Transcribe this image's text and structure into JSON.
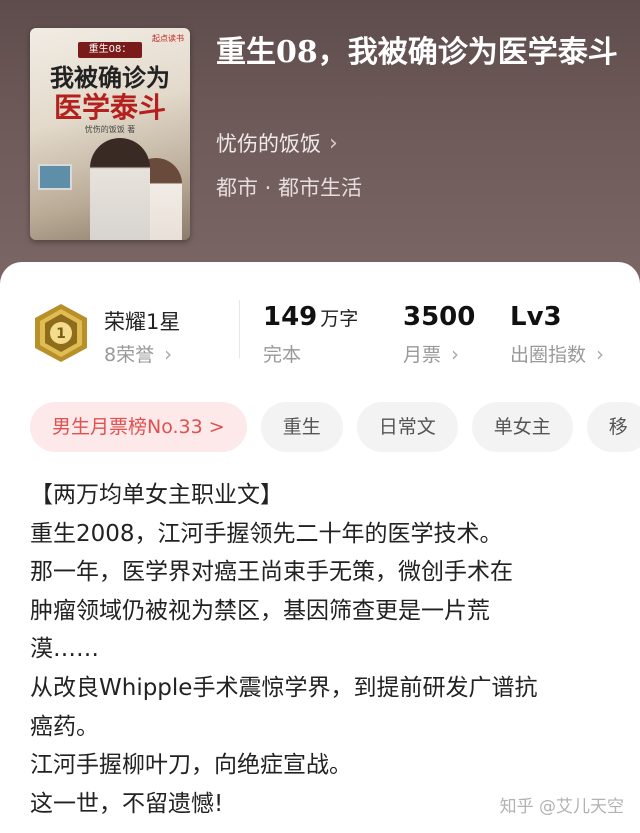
{
  "book": {
    "title": "重生08，我被确诊为医学泰斗",
    "author": "忧伤的饭饭",
    "genre": "都市 · 都市生活"
  },
  "cover": {
    "publisher": "起点读书",
    "series_tag": "重生08：",
    "title_line1": "我被确诊为",
    "title_line2": "医学泰斗",
    "author_line": "忧伤的饭饭 著"
  },
  "honor": {
    "name": "荣耀1星",
    "sub": "8荣誉",
    "badge_number": "1"
  },
  "stats": [
    {
      "value": "149",
      "unit": "万字",
      "label": "完本"
    },
    {
      "value": "3500",
      "unit": "",
      "label": "月票"
    },
    {
      "value": "Lv3",
      "unit": "",
      "label": "出圈指数"
    }
  ],
  "tags": [
    "男生月票榜No.33 >",
    "重生",
    "日常文",
    "单女主",
    "移"
  ],
  "description": [
    "【两万均单女主职业文】",
    "重生2008，江河手握领先二十年的医学技术。",
    "那一年，医学界对癌王尚束手无策，微创手术在",
    "肿瘤领域仍被视为禁区，基因筛查更是一片荒",
    "漠……",
    "从改良Whipple手术震惊学界，到提前研发广谱抗",
    "癌药。",
    "江河手握柳叶刀，向绝症宣战。",
    "这一世，不留遗憾!"
  ],
  "watermark": "知乎 @艾儿天空",
  "colors": {
    "hero_bg": "#6f5b5a",
    "rank_tag_bg": "#fde9e9",
    "rank_tag_text": "#e0504f",
    "badge_gold": "#c9a227"
  }
}
